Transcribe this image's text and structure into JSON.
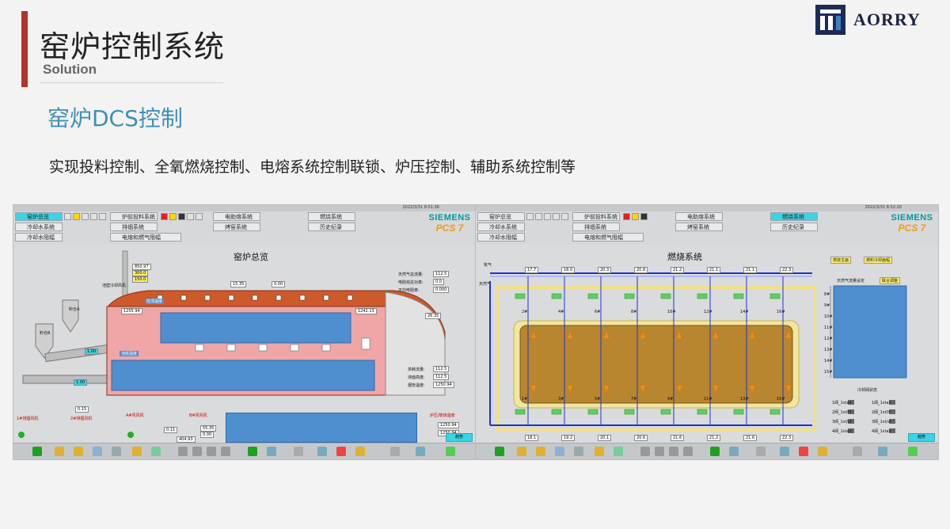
{
  "header": {
    "title": "窑炉控制系统",
    "subtitle": "Solution",
    "brand": "AORRY",
    "accent_color": "#b5322a"
  },
  "section": {
    "title": "窑炉DCS控制",
    "description": "实现投料控制、全氧燃烧控制、电熔系统控制联锁、炉压控制、辅助系统控制等"
  },
  "screens": {
    "left": {
      "datetime": "2022/3/31 8:51:36",
      "nav": [
        "窑炉总览",
        "炉前投料系统",
        "电助熔系统",
        "燃烧系统",
        "冷却水系统",
        "排烟系统",
        "烤窑系统",
        "历史纪录",
        "冷却水阻幅",
        "电熔和燃气阻幅"
      ],
      "active_nav": "窑炉总览",
      "siemens": "SIEMENS",
      "pcs": "PCS 7",
      "panel_title": "窑炉总览",
      "readouts": {
        "gas_flow_label": "天然气总流量:",
        "gas_flow": "112.5",
        "electric_label": "电助熔总功率:",
        "electric": "0.0",
        "power_label": "平均电阻率:",
        "power": "0.000",
        "flow1_label": "单耗流量:",
        "flow1": "112.5",
        "flow2_label": "液面高度:",
        "flow2": "112.5",
        "flow3_label": "烟管温度:",
        "flow3": "1250.94"
      },
      "labels": {
        "cooling_fan": "池壁冷却风机",
        "hopper_a": "料仓A",
        "hopper_b": "料仓B",
        "roof_temp": "碹顶温度",
        "bottom_temp": "池底温度",
        "fan1": "1#排烟风机",
        "fan2": "2#排烟风机",
        "fan_a": "A#风风机",
        "fan_b": "B#风风机",
        "exhaust": "炉压/玻璃温度"
      },
      "values": {
        "v1": "850.97",
        "v2": "300.0",
        "v3": "150.0",
        "v4": "1255.94",
        "v5": "1242.13",
        "v6": "1.00",
        "v7": "1.00",
        "v8": "15.35",
        "v9": "0.00",
        "v10": "26.35",
        "v11": "0.15",
        "v12": "404.93",
        "v13": "0.11",
        "v14": "55.35",
        "v15": "0.00",
        "v16": "1250.94",
        "v17": "1250.94"
      },
      "status_button": "趋势"
    },
    "right": {
      "datetime": "2022/3/31 8:52:20",
      "nav": [
        "窑炉总览",
        "炉前投料系统",
        "电助熔系统",
        "燃烧系统",
        "冷却水系统",
        "排烟系统",
        "烤窑系统",
        "历史纪录",
        "冷却水阻幅",
        "电熔和燃气阻幅"
      ],
      "active_nav": "燃烧系统",
      "siemens": "SIEMENS",
      "pcs": "PCS 7",
      "panel_title": "燃烧系统",
      "oxygen_label": "氧气",
      "gas_label": "天然气",
      "top_flows": [
        "17.7",
        "18.0",
        "20.3",
        "20.8",
        "21.2",
        "21.1",
        "21.1",
        "22.3"
      ],
      "bottom_flows": [
        "18.1",
        "19.2",
        "20.1",
        "20.6",
        "21.6",
        "21.2",
        "21.6",
        "22.3"
      ],
      "top_burners": [
        "2#",
        "4#",
        "6#",
        "8#",
        "10#",
        "12#",
        "14#",
        "16#"
      ],
      "bottom_burners": [
        "1#",
        "3#",
        "5#",
        "7#",
        "9#",
        "11#",
        "13#",
        "15#"
      ],
      "btn_main": "燃烧主画",
      "btn_seq": "燃料冷却画幅",
      "gas_setting_label": "天然气流量设定",
      "gas_setting_btn": "联合调整",
      "y_ticks": [
        "8#",
        "9#",
        "10#",
        "11#",
        "12#",
        "13#",
        "14#",
        "15#"
      ],
      "cool_status_title": "冷却阀状态",
      "cool_status": [
        "1阀_1stair",
        "1阀_1stair",
        "2阀_1st/H",
        "2阀_1st/H",
        "3阀_1st/st",
        "3阀_1st/st",
        "4阀_1stair",
        "4阀_1stair"
      ],
      "status_button": "趋势"
    }
  }
}
